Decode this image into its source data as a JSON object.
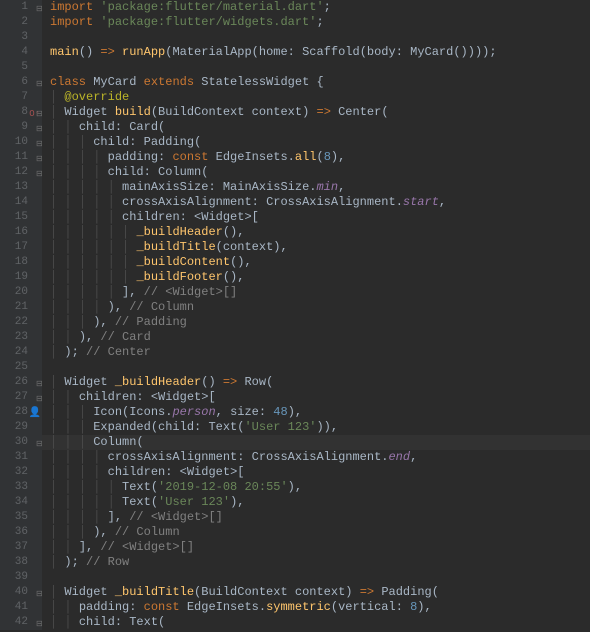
{
  "lineCount": 42,
  "highlightedLine": 30,
  "gutterMarkers": {
    "8": {
      "icon": "override",
      "glyph": "O↑"
    },
    "28": {
      "icon": "person",
      "glyph": "👤"
    }
  },
  "foldMarkers": [
    1,
    6,
    8,
    9,
    10,
    11,
    12,
    26,
    27,
    30,
    40,
    42
  ],
  "lines": [
    {
      "n": 1,
      "indent": 0,
      "tokens": [
        [
          "kw",
          "import "
        ],
        [
          "str",
          "'package:flutter/material.dart'"
        ],
        [
          "op",
          ";"
        ]
      ]
    },
    {
      "n": 2,
      "indent": 0,
      "tokens": [
        [
          "kw",
          "import "
        ],
        [
          "str",
          "'package:flutter/widgets.dart'"
        ],
        [
          "op",
          ";"
        ]
      ]
    },
    {
      "n": 3,
      "indent": 0,
      "tokens": []
    },
    {
      "n": 4,
      "indent": 0,
      "tokens": [
        [
          "fn",
          "main"
        ],
        [
          "paren",
          "() "
        ],
        [
          "kw",
          "=> "
        ],
        [
          "fn",
          "runApp"
        ],
        [
          "paren",
          "("
        ],
        [
          "cls",
          "MaterialApp"
        ],
        [
          "paren",
          "("
        ],
        [
          "named",
          "home: "
        ],
        [
          "cls",
          "Scaffold"
        ],
        [
          "paren",
          "("
        ],
        [
          "named",
          "body: "
        ],
        [
          "cls",
          "MyCard"
        ],
        [
          "paren",
          "())));"
        ]
      ]
    },
    {
      "n": 5,
      "indent": 0,
      "tokens": []
    },
    {
      "n": 6,
      "indent": 0,
      "tokens": [
        [
          "kw",
          "class "
        ],
        [
          "cls",
          "MyCard "
        ],
        [
          "kw",
          "extends "
        ],
        [
          "cls",
          "StatelessWidget "
        ],
        [
          "paren",
          "{"
        ]
      ]
    },
    {
      "n": 7,
      "indent": 1,
      "tokens": [
        [
          "meta",
          "@override"
        ]
      ]
    },
    {
      "n": 8,
      "indent": 1,
      "tokens": [
        [
          "type",
          "Widget "
        ],
        [
          "fn",
          "build"
        ],
        [
          "paren",
          "("
        ],
        [
          "type",
          "BuildContext "
        ],
        [
          "param",
          "context"
        ],
        [
          "paren",
          ") "
        ],
        [
          "kw",
          "=> "
        ],
        [
          "cls",
          "Center"
        ],
        [
          "paren",
          "("
        ]
      ]
    },
    {
      "n": 9,
      "indent": 2,
      "tokens": [
        [
          "named",
          "child: "
        ],
        [
          "cls",
          "Card"
        ],
        [
          "paren",
          "("
        ]
      ]
    },
    {
      "n": 10,
      "indent": 3,
      "tokens": [
        [
          "named",
          "child: "
        ],
        [
          "cls",
          "Padding"
        ],
        [
          "paren",
          "("
        ]
      ]
    },
    {
      "n": 11,
      "indent": 4,
      "tokens": [
        [
          "named",
          "padding: "
        ],
        [
          "kw",
          "const "
        ],
        [
          "cls",
          "EdgeInsets"
        ],
        [
          "op",
          "."
        ],
        [
          "fn",
          "all"
        ],
        [
          "paren",
          "("
        ],
        [
          "num",
          "8"
        ],
        [
          "paren",
          ")"
        ],
        [
          "op",
          ","
        ]
      ]
    },
    {
      "n": 12,
      "indent": 4,
      "tokens": [
        [
          "named",
          "child: "
        ],
        [
          "cls",
          "Column"
        ],
        [
          "paren",
          "("
        ]
      ]
    },
    {
      "n": 13,
      "indent": 5,
      "tokens": [
        [
          "named",
          "mainAxisSize: "
        ],
        [
          "cls",
          "MainAxisSize"
        ],
        [
          "op",
          "."
        ],
        [
          "prop",
          "min"
        ],
        [
          "op",
          ","
        ]
      ]
    },
    {
      "n": 14,
      "indent": 5,
      "tokens": [
        [
          "named",
          "crossAxisAlignment: "
        ],
        [
          "cls",
          "CrossAxisAlignment"
        ],
        [
          "op",
          "."
        ],
        [
          "prop",
          "start"
        ],
        [
          "op",
          ","
        ]
      ]
    },
    {
      "n": 15,
      "indent": 5,
      "tokens": [
        [
          "named",
          "children: "
        ],
        [
          "op",
          "<"
        ],
        [
          "type",
          "Widget"
        ],
        [
          "op",
          ">["
        ]
      ]
    },
    {
      "n": 16,
      "indent": 6,
      "tokens": [
        [
          "fn",
          "_buildHeader"
        ],
        [
          "paren",
          "()"
        ],
        [
          "op",
          ","
        ]
      ]
    },
    {
      "n": 17,
      "indent": 6,
      "tokens": [
        [
          "fn",
          "_buildTitle"
        ],
        [
          "paren",
          "("
        ],
        [
          "param",
          "context"
        ],
        [
          "paren",
          ")"
        ],
        [
          "op",
          ","
        ]
      ]
    },
    {
      "n": 18,
      "indent": 6,
      "tokens": [
        [
          "fn",
          "_buildContent"
        ],
        [
          "paren",
          "()"
        ],
        [
          "op",
          ","
        ]
      ]
    },
    {
      "n": 19,
      "indent": 6,
      "tokens": [
        [
          "fn",
          "_buildFooter"
        ],
        [
          "paren",
          "()"
        ],
        [
          "op",
          ","
        ]
      ]
    },
    {
      "n": 20,
      "indent": 5,
      "tokens": [
        [
          "op",
          "]"
        ],
        [
          "op",
          ", "
        ],
        [
          "comment",
          "// <Widget>[]"
        ]
      ]
    },
    {
      "n": 21,
      "indent": 4,
      "tokens": [
        [
          "paren",
          ")"
        ],
        [
          "op",
          ", "
        ],
        [
          "comment",
          "// Column"
        ]
      ]
    },
    {
      "n": 22,
      "indent": 3,
      "tokens": [
        [
          "paren",
          ")"
        ],
        [
          "op",
          ", "
        ],
        [
          "comment",
          "// Padding"
        ]
      ]
    },
    {
      "n": 23,
      "indent": 2,
      "tokens": [
        [
          "paren",
          ")"
        ],
        [
          "op",
          ", "
        ],
        [
          "comment",
          "// Card"
        ]
      ]
    },
    {
      "n": 24,
      "indent": 1,
      "tokens": [
        [
          "paren",
          ")"
        ],
        [
          "op",
          "; "
        ],
        [
          "comment",
          "// Center"
        ]
      ]
    },
    {
      "n": 25,
      "indent": 0,
      "tokens": []
    },
    {
      "n": 26,
      "indent": 1,
      "tokens": [
        [
          "type",
          "Widget "
        ],
        [
          "fn",
          "_buildHeader"
        ],
        [
          "paren",
          "() "
        ],
        [
          "kw",
          "=> "
        ],
        [
          "cls",
          "Row"
        ],
        [
          "paren",
          "("
        ]
      ]
    },
    {
      "n": 27,
      "indent": 2,
      "tokens": [
        [
          "named",
          "children: "
        ],
        [
          "op",
          "<"
        ],
        [
          "type",
          "Widget"
        ],
        [
          "op",
          ">["
        ]
      ]
    },
    {
      "n": 28,
      "indent": 3,
      "tokens": [
        [
          "cls",
          "Icon"
        ],
        [
          "paren",
          "("
        ],
        [
          "cls",
          "Icons"
        ],
        [
          "op",
          "."
        ],
        [
          "prop",
          "person"
        ],
        [
          "op",
          ", "
        ],
        [
          "named",
          "size: "
        ],
        [
          "num",
          "48"
        ],
        [
          "paren",
          ")"
        ],
        [
          "op",
          ","
        ]
      ]
    },
    {
      "n": 29,
      "indent": 3,
      "tokens": [
        [
          "cls",
          "Expanded"
        ],
        [
          "paren",
          "("
        ],
        [
          "named",
          "child: "
        ],
        [
          "cls",
          "Text"
        ],
        [
          "paren",
          "("
        ],
        [
          "str",
          "'User 123'"
        ],
        [
          "paren",
          "))"
        ],
        [
          "op",
          ","
        ]
      ]
    },
    {
      "n": 30,
      "indent": 3,
      "tokens": [
        [
          "cls",
          "Column"
        ],
        [
          "paren",
          "("
        ]
      ]
    },
    {
      "n": 31,
      "indent": 4,
      "tokens": [
        [
          "named",
          "crossAxisAlignment: "
        ],
        [
          "cls",
          "CrossAxisAlignment"
        ],
        [
          "op",
          "."
        ],
        [
          "prop",
          "end"
        ],
        [
          "op",
          ","
        ]
      ]
    },
    {
      "n": 32,
      "indent": 4,
      "tokens": [
        [
          "named",
          "children: "
        ],
        [
          "op",
          "<"
        ],
        [
          "type",
          "Widget"
        ],
        [
          "op",
          ">["
        ]
      ]
    },
    {
      "n": 33,
      "indent": 5,
      "tokens": [
        [
          "cls",
          "Text"
        ],
        [
          "paren",
          "("
        ],
        [
          "str",
          "'2019-12-08 20:55'"
        ],
        [
          "paren",
          ")"
        ],
        [
          "op",
          ","
        ]
      ]
    },
    {
      "n": 34,
      "indent": 5,
      "tokens": [
        [
          "cls",
          "Text"
        ],
        [
          "paren",
          "("
        ],
        [
          "str",
          "'User 123'"
        ],
        [
          "paren",
          ")"
        ],
        [
          "op",
          ","
        ]
      ]
    },
    {
      "n": 35,
      "indent": 4,
      "tokens": [
        [
          "op",
          "]"
        ],
        [
          "op",
          ", "
        ],
        [
          "comment",
          "// <Widget>[]"
        ]
      ]
    },
    {
      "n": 36,
      "indent": 3,
      "tokens": [
        [
          "paren",
          ")"
        ],
        [
          "op",
          ", "
        ],
        [
          "comment",
          "// Column"
        ]
      ]
    },
    {
      "n": 37,
      "indent": 2,
      "tokens": [
        [
          "op",
          "]"
        ],
        [
          "op",
          ", "
        ],
        [
          "comment",
          "// <Widget>[]"
        ]
      ]
    },
    {
      "n": 38,
      "indent": 1,
      "tokens": [
        [
          "paren",
          ")"
        ],
        [
          "op",
          "; "
        ],
        [
          "comment",
          "// Row"
        ]
      ]
    },
    {
      "n": 39,
      "indent": 0,
      "tokens": []
    },
    {
      "n": 40,
      "indent": 1,
      "tokens": [
        [
          "type",
          "Widget "
        ],
        [
          "fn",
          "_buildTitle"
        ],
        [
          "paren",
          "("
        ],
        [
          "type",
          "BuildContext "
        ],
        [
          "param",
          "context"
        ],
        [
          "paren",
          ") "
        ],
        [
          "kw",
          "=> "
        ],
        [
          "cls",
          "Padding"
        ],
        [
          "paren",
          "("
        ]
      ]
    },
    {
      "n": 41,
      "indent": 2,
      "tokens": [
        [
          "named",
          "padding: "
        ],
        [
          "kw",
          "const "
        ],
        [
          "cls",
          "EdgeInsets"
        ],
        [
          "op",
          "."
        ],
        [
          "fn",
          "symmetric"
        ],
        [
          "paren",
          "("
        ],
        [
          "named",
          "vertical: "
        ],
        [
          "num",
          "8"
        ],
        [
          "paren",
          ")"
        ],
        [
          "op",
          ","
        ]
      ]
    },
    {
      "n": 42,
      "indent": 2,
      "tokens": [
        [
          "named",
          "child: "
        ],
        [
          "cls",
          "Text"
        ],
        [
          "paren",
          "("
        ]
      ]
    }
  ]
}
